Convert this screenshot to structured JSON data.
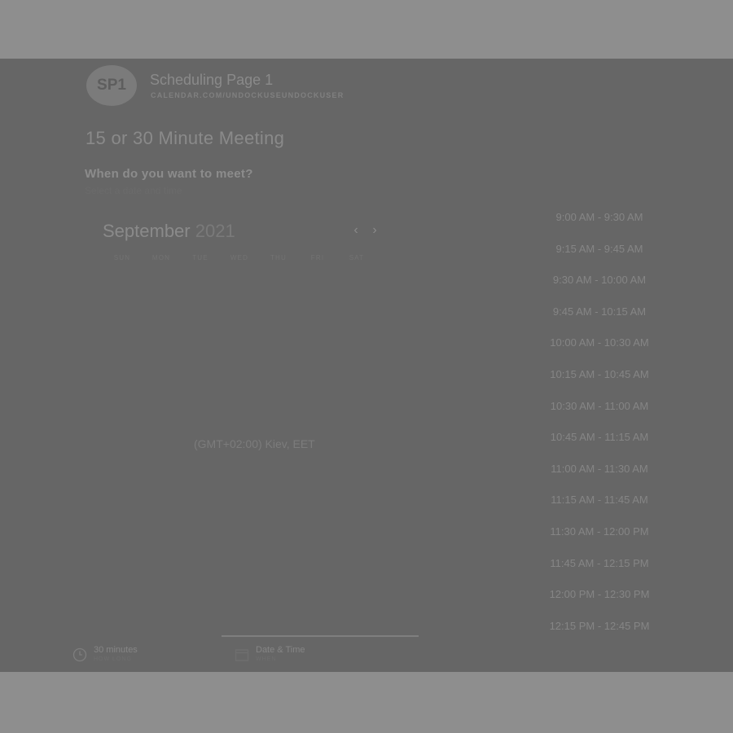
{
  "header": {
    "avatar_text": "SP1",
    "page_name": "Scheduling Page 1",
    "page_url": "CALENDAR.COM/UNDOCKUSEUNDOCKUSER"
  },
  "meeting": {
    "title": "15 or 30 Minute Meeting",
    "when_title": "When do you want to meet?",
    "when_subtitle": "Select a date and time"
  },
  "calendar": {
    "month": "September",
    "year": "2021",
    "prev_icon": "chevron-left-icon",
    "next_icon": "chevron-right-icon",
    "weekdays": [
      "SUN",
      "MON",
      "TUE",
      "WED",
      "THU",
      "FRI",
      "SAT"
    ]
  },
  "timezone": "(GMT+02:00) Kiev, EET",
  "time_slots": [
    "9:00 AM - 9:30 AM",
    "9:15 AM - 9:45 AM",
    "9:30 AM - 10:00 AM",
    "9:45 AM - 10:15 AM",
    "10:00 AM - 10:30 AM",
    "10:15 AM - 10:45 AM",
    "10:30 AM - 11:00 AM",
    "10:45 AM - 11:15 AM",
    "11:00 AM - 11:30 AM",
    "11:15 AM - 11:45 AM",
    "11:30 AM - 12:00 PM",
    "11:45 AM - 12:15 PM",
    "12:00 PM - 12:30 PM",
    "12:15 PM - 12:45 PM"
  ],
  "footer": {
    "duration": {
      "label": "30 minutes",
      "sublabel": "HOW LONG",
      "icon": "clock-icon"
    },
    "datetime": {
      "label": "Date & Time",
      "sublabel": "WHEN",
      "icon": "calendar-icon"
    }
  },
  "colors": {
    "backdrop": "#8e8e8e",
    "panel": "#666666"
  }
}
